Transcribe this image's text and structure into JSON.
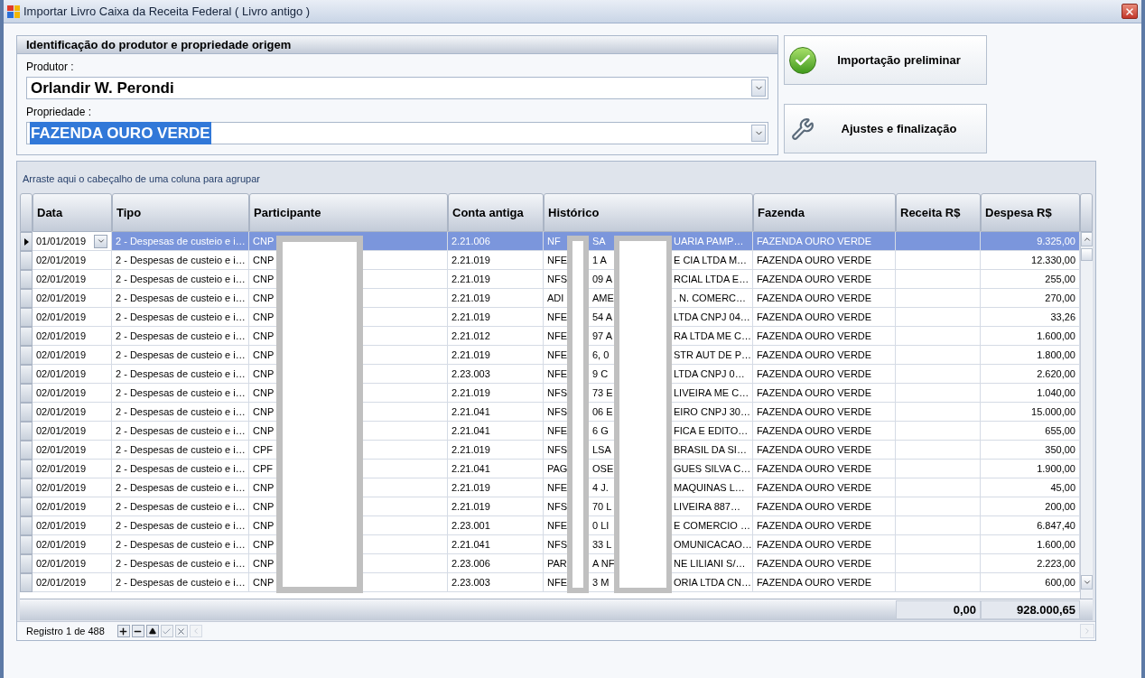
{
  "window": {
    "title": "Importar Livro Caixa da Receita Federal ( Livro antigo )"
  },
  "group": {
    "title": "Identificação do produtor e propriedade origem",
    "fields": [
      {
        "label": "Produtor :",
        "value": "Orlandir W. Perondi",
        "highlighted": false
      },
      {
        "label": "Propriedade :",
        "value": "FAZENDA OURO VERDE",
        "highlighted": true
      }
    ]
  },
  "actions": [
    {
      "label": "Importação preliminar",
      "kind": "check"
    },
    {
      "label": "Ajustes e finalização",
      "kind": "tools"
    }
  ],
  "grid": {
    "group_hint": "Arraste aqui o cabeçalho de uma coluna para agrupar",
    "columns": [
      "Data",
      "Tipo",
      "Participante",
      "Conta antiga",
      "Histórico",
      "Fazenda",
      "Receita R$",
      "Despesa R$"
    ],
    "rows": [
      {
        "selected": true,
        "data": "01/01/2019",
        "tipo": "2 - Despesas de custeio e i…",
        "participante": "CNP",
        "conta": "2.21.006",
        "historico": [
          "NF",
          "SA",
          "UARIA PAMP…"
        ],
        "fazenda": "FAZENDA OURO VERDE",
        "despesa": "9.325,00"
      },
      {
        "selected": false,
        "data": "02/01/2019",
        "tipo": "2 - Despesas de custeio e i…",
        "participante": "CNP",
        "conta": "2.21.019",
        "historico": [
          "NFE",
          "1 A",
          "E CIA LTDA M…"
        ],
        "fazenda": "FAZENDA OURO VERDE",
        "despesa": "12.330,00"
      },
      {
        "selected": false,
        "data": "02/01/2019",
        "tipo": "2 - Despesas de custeio e i…",
        "participante": "CNP",
        "conta": "2.21.019",
        "historico": [
          "NFS",
          "09 A",
          "RCIAL LTDA E…"
        ],
        "fazenda": "FAZENDA OURO VERDE",
        "despesa": "255,00"
      },
      {
        "selected": false,
        "data": "02/01/2019",
        "tipo": "2 - Despesas de custeio e i…",
        "participante": "CNP",
        "conta": "2.21.019",
        "historico": [
          "ADI",
          "AME",
          ". N. COMERC…"
        ],
        "fazenda": "FAZENDA OURO VERDE",
        "despesa": "270,00"
      },
      {
        "selected": false,
        "data": "02/01/2019",
        "tipo": "2 - Despesas de custeio e i…",
        "participante": "CNP",
        "conta": "2.21.019",
        "historico": [
          "NFE",
          "54 A",
          "LTDA CNPJ 04…"
        ],
        "fazenda": "FAZENDA OURO VERDE",
        "despesa": "33,26"
      },
      {
        "selected": false,
        "data": "02/01/2019",
        "tipo": "2 - Despesas de custeio e i…",
        "participante": "CNP",
        "conta": "2.21.012",
        "historico": [
          "NFE",
          "97 A",
          "RA LTDA ME C…"
        ],
        "fazenda": "FAZENDA OURO VERDE",
        "despesa": "1.600,00"
      },
      {
        "selected": false,
        "data": "02/01/2019",
        "tipo": "2 - Despesas de custeio e i…",
        "participante": "CNP",
        "conta": "2.21.019",
        "historico": [
          "NFE",
          "6, 0",
          "STR AUT DE P…"
        ],
        "fazenda": "FAZENDA OURO VERDE",
        "despesa": "1.800,00"
      },
      {
        "selected": false,
        "data": "02/01/2019",
        "tipo": "2 - Despesas de custeio e i…",
        "participante": "CNP",
        "conta": "2.23.003",
        "historico": [
          "NFE",
          "9 C",
          "LTDA CNPJ 0…"
        ],
        "fazenda": "FAZENDA OURO VERDE",
        "despesa": "2.620,00"
      },
      {
        "selected": false,
        "data": "02/01/2019",
        "tipo": "2 - Despesas de custeio e i…",
        "participante": "CNP",
        "conta": "2.21.019",
        "historico": [
          "NFS",
          "73 E",
          "LIVEIRA ME C…"
        ],
        "fazenda": "FAZENDA OURO VERDE",
        "despesa": "1.040,00"
      },
      {
        "selected": false,
        "data": "02/01/2019",
        "tipo": "2 - Despesas de custeio e i…",
        "participante": "CNP",
        "conta": "2.21.041",
        "historico": [
          "NFS",
          "06 E",
          "EIRO CNPJ 30…"
        ],
        "fazenda": "FAZENDA OURO VERDE",
        "despesa": "15.000,00"
      },
      {
        "selected": false,
        "data": "02/01/2019",
        "tipo": "2 - Despesas de custeio e i…",
        "participante": "CNP",
        "conta": "2.21.041",
        "historico": [
          "NFE",
          "6 G",
          "FICA E EDITO…"
        ],
        "fazenda": "FAZENDA OURO VERDE",
        "despesa": "655,00"
      },
      {
        "selected": false,
        "data": "02/01/2019",
        "tipo": "2 - Despesas de custeio e i…",
        "participante": "CPF",
        "conta": "2.21.019",
        "historico": [
          "NFS",
          "LSA",
          "BRASIL DA SI…"
        ],
        "fazenda": "FAZENDA OURO VERDE",
        "despesa": "350,00"
      },
      {
        "selected": false,
        "data": "02/01/2019",
        "tipo": "2 - Despesas de custeio e i…",
        "participante": "CPF",
        "conta": "2.21.041",
        "historico": [
          "PAG",
          "OSE",
          "GUES SILVA C…"
        ],
        "fazenda": "FAZENDA OURO VERDE",
        "despesa": "1.900,00"
      },
      {
        "selected": false,
        "data": "02/01/2019",
        "tipo": "2 - Despesas de custeio e i…",
        "participante": "CNP",
        "conta": "2.21.019",
        "historico": [
          "NFE",
          "4 J.",
          "MAQUINAS L…"
        ],
        "fazenda": "FAZENDA OURO VERDE",
        "despesa": "45,00"
      },
      {
        "selected": false,
        "data": "02/01/2019",
        "tipo": "2 - Despesas de custeio e i…",
        "participante": "CNP",
        "conta": "2.21.019",
        "historico": [
          "NFS",
          "70 L",
          "LIVEIRA 887…"
        ],
        "fazenda": "FAZENDA OURO VERDE",
        "despesa": "200,00"
      },
      {
        "selected": false,
        "data": "02/01/2019",
        "tipo": "2 - Despesas de custeio e i…",
        "participante": "CNP",
        "conta": "2.23.001",
        "historico": [
          "NFE",
          "0 LI",
          "E COMERCIO …"
        ],
        "fazenda": "FAZENDA OURO VERDE",
        "despesa": "6.847,40"
      },
      {
        "selected": false,
        "data": "02/01/2019",
        "tipo": "2 - Despesas de custeio e i…",
        "participante": "CNP",
        "conta": "2.21.041",
        "historico": [
          "NFS",
          "33 L",
          "OMUNICACAO…"
        ],
        "fazenda": "FAZENDA OURO VERDE",
        "despesa": "1.600,00"
      },
      {
        "selected": false,
        "data": "02/01/2019",
        "tipo": "2 - Despesas de custeio e i…",
        "participante": "CNP",
        "conta": "2.23.006",
        "historico": [
          "PAR",
          "A NF",
          "NE LILIANI S/…"
        ],
        "fazenda": "FAZENDA OURO VERDE",
        "despesa": "2.223,00"
      },
      {
        "selected": false,
        "data": "02/01/2019",
        "tipo": "2 - Despesas de custeio e i…",
        "participante": "CNP",
        "conta": "2.23.003",
        "historico": [
          "NFE",
          "3 M",
          "ORIA LTDA CN…"
        ],
        "fazenda": "FAZENDA OURO VERDE",
        "despesa": "600,00"
      }
    ],
    "totals": {
      "receita": "0,00",
      "despesa": "928.000,65"
    },
    "navigator": {
      "record": "Registro 1 de 488"
    }
  }
}
